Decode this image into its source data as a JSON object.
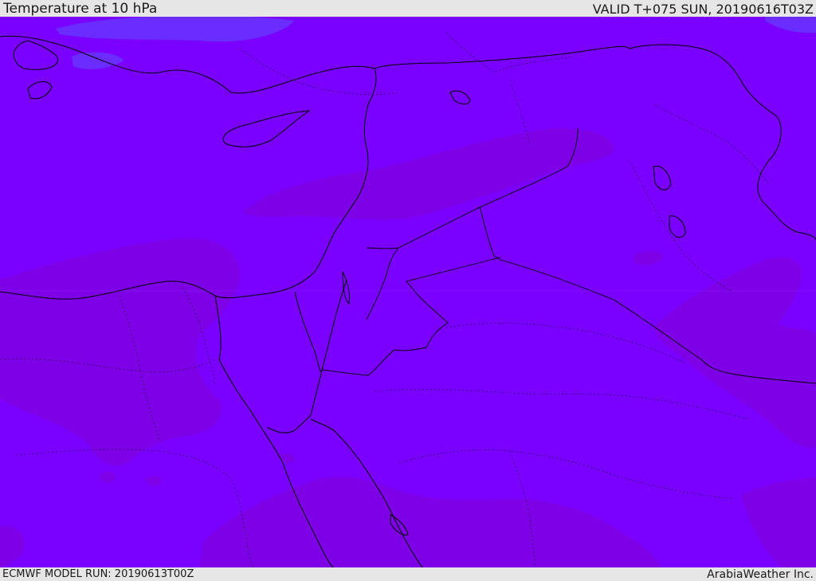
{
  "header": {
    "title": "Temperature at 10 hPa",
    "valid": "VALID T+075 SUN, 20190616T03Z"
  },
  "footer": {
    "model_run": "ECMWF MODEL RUN: 20190613T00Z",
    "credit": "ArabiaWeather Inc."
  },
  "colors": {
    "base_fill": "#7a00ff",
    "warm_fill": "#7e00e6",
    "cool_fill": "#6a2cff",
    "coastline": "#000000",
    "frame": "#e6e6e6"
  }
}
